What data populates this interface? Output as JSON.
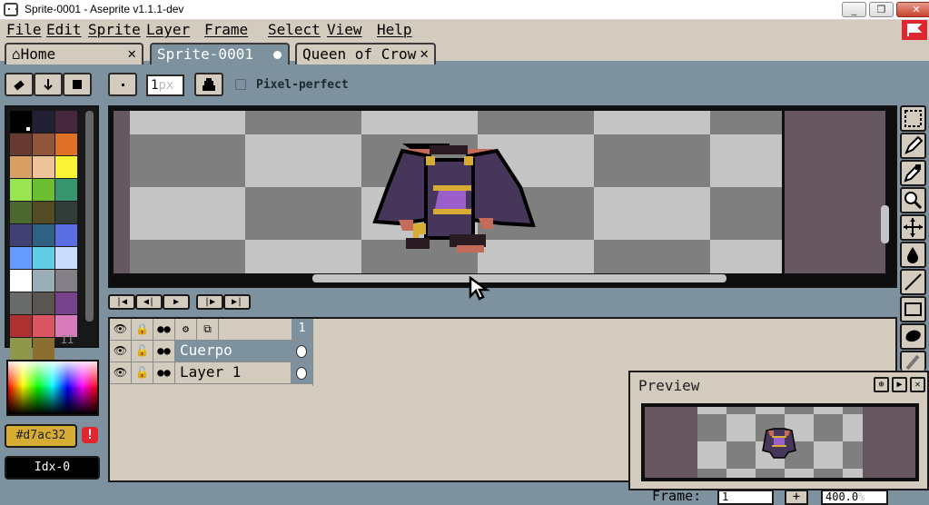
{
  "window": {
    "title": "Sprite-0001 - Aseprite v1.1.1-dev",
    "minimize": "_",
    "maximize": "❐",
    "close": "✕"
  },
  "menu": [
    "File",
    "Edit",
    "Sprite",
    "Layer",
    "Frame",
    "Select",
    "View",
    "Help"
  ],
  "tabs": [
    {
      "label": "Home",
      "icon": "home-icon",
      "close": "✕"
    },
    {
      "label": "Sprite-0001",
      "active": true,
      "modified": true
    },
    {
      "label": "Queen of Crow",
      "close": "✕"
    }
  ],
  "context_bar": {
    "brush_size_value": "1",
    "brush_size_unit": "px",
    "pixel_perfect_label": "Pixel-perfect",
    "pixel_perfect_checked": false
  },
  "palette": {
    "colors": [
      "#000000",
      "#222034",
      "#45283c",
      "#663931",
      "#8f563b",
      "#df7126",
      "#d9a066",
      "#eec39a",
      "#fbf236",
      "#99e550",
      "#6abe30",
      "#37946e",
      "#4b692f",
      "#524b24",
      "#323c39",
      "#3f3f74",
      "#306082",
      "#5b6ee1",
      "#639bff",
      "#5fcde4",
      "#cbdbfc",
      "#ffffff",
      "#9badb7",
      "#847e87",
      "#696a6a",
      "#595652",
      "#76428a",
      "#ac3232",
      "#d95763",
      "#d77bba",
      "#8f974a",
      "#8a6f30"
    ],
    "more_label": "II"
  },
  "colors": {
    "foreground_label": "#d7ac32",
    "foreground_hex": "#d7ac32",
    "warning_icon_text": "!",
    "background_label": "Idx-0",
    "background_hex": "#000000",
    "accent": "#7d929e",
    "panel": "#d3cbbe"
  },
  "playback": [
    "first-frame-icon",
    "prev-frame-icon",
    "play-icon",
    "next-frame-icon",
    "last-frame-icon"
  ],
  "timeline": {
    "header_icons": [
      "eye-icon",
      "lock-icon",
      "continuous-icon",
      "gear-icon",
      "link-icon"
    ],
    "frame_number": "1",
    "layers": [
      {
        "name": "Cuerpo",
        "selected": true
      },
      {
        "name": "Layer 1",
        "selected": false
      }
    ]
  },
  "preview": {
    "title": "Preview"
  },
  "status": {
    "frame_label": "Frame:",
    "frame_value": "1",
    "add_frame": "+",
    "zoom_value": "400.0",
    "zoom_unit": "%"
  },
  "tools": [
    "marquee-icon",
    "pencil-icon",
    "eyedropper-icon",
    "zoom-icon",
    "move-icon",
    "paint-bucket-icon",
    "line-icon",
    "rectangle-icon",
    "contour-icon",
    "blur-icon"
  ]
}
